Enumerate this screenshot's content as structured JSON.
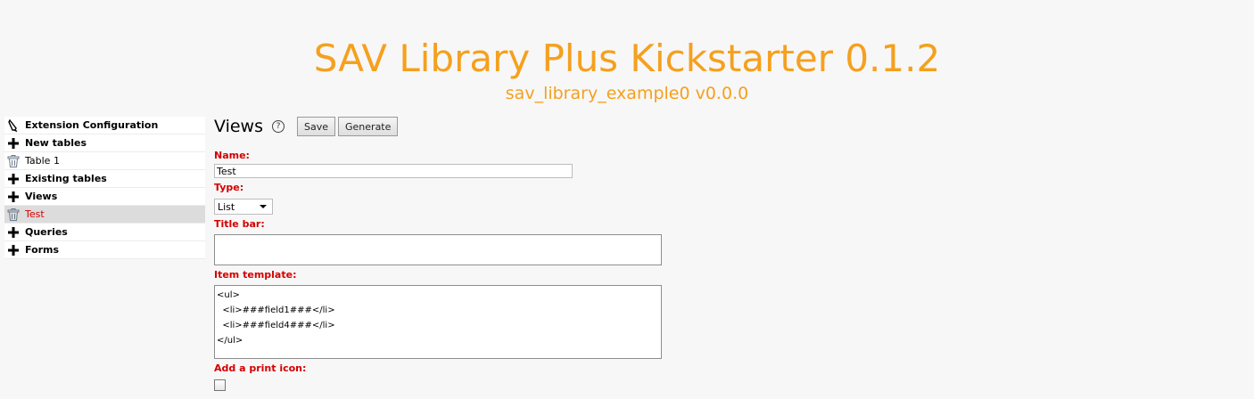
{
  "header": {
    "title": "SAV Library Plus Kickstarter 0.1.2",
    "subtitle": "sav_library_example0 v0.0.0"
  },
  "sidebar": {
    "items": [
      {
        "label": "Extension Configuration",
        "icon": "pen-icon"
      },
      {
        "label": "New tables",
        "icon": "plus-icon"
      },
      {
        "label": "Table 1",
        "icon": "trash-icon"
      },
      {
        "label": "Existing tables",
        "icon": "plus-icon"
      },
      {
        "label": "Views",
        "icon": "plus-icon"
      },
      {
        "label": "Test",
        "icon": "trash-icon"
      },
      {
        "label": "Queries",
        "icon": "plus-icon"
      },
      {
        "label": "Forms",
        "icon": "plus-icon"
      }
    ]
  },
  "main": {
    "title": "Views",
    "help_glyph": "?",
    "save_label": "Save",
    "generate_label": "Generate",
    "name_label": "Name:",
    "name_value": "Test",
    "type_label": "Type:",
    "type_value": "List",
    "title_bar_label": "Title bar:",
    "title_bar_value": "",
    "item_template_label": "Item template:",
    "item_template_value": "<ul>\n  <li>###field1###</li>\n  <li>###field4###</li>\n</ul>",
    "print_icon_label": "Add a print icon:",
    "print_icon_checked": false
  },
  "colors": {
    "accent": "#f5a01e",
    "label_red": "#d40000",
    "selected_bg": "#dcdcdc"
  }
}
